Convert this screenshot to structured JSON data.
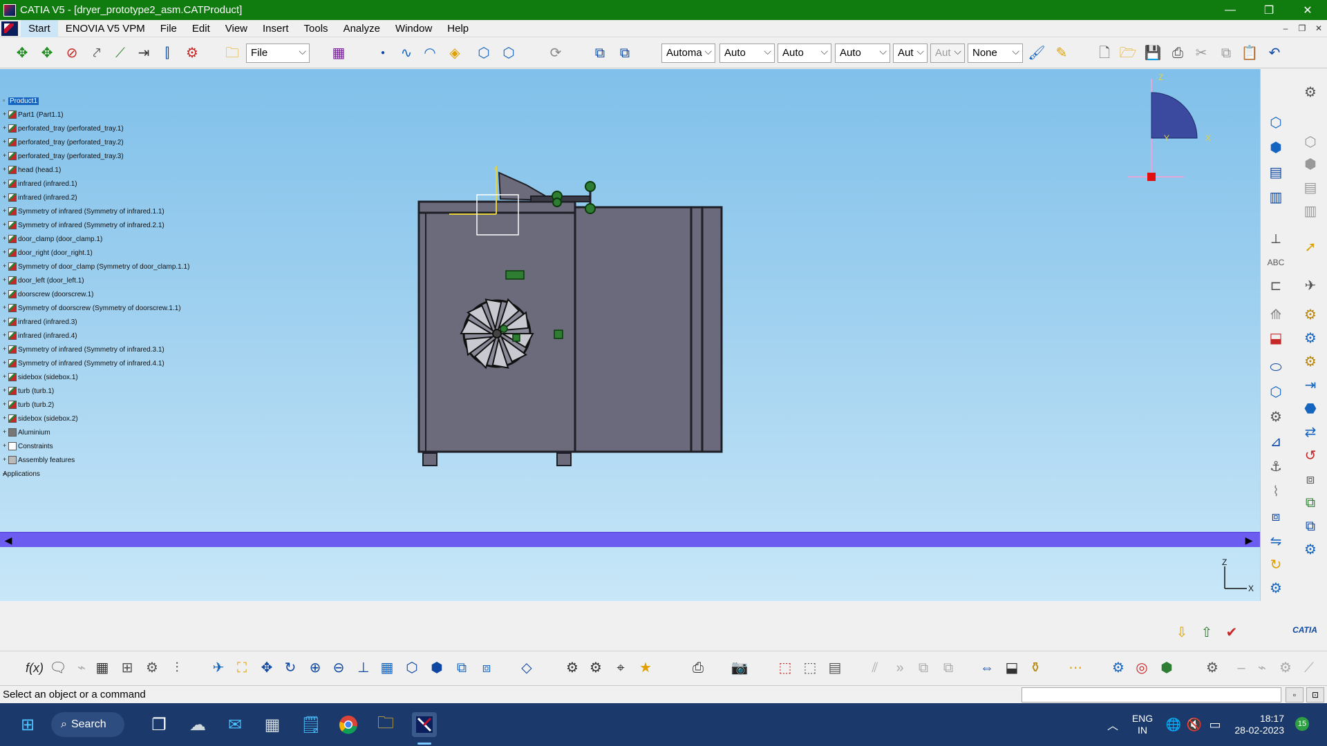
{
  "window": {
    "title": "CATIA V5 - [dryer_prototype2_asm.CATProduct]",
    "controls": {
      "minimize": "—",
      "restore": "❐",
      "close": "✕"
    }
  },
  "menubar": {
    "items": [
      "Start",
      "ENOVIA V5 VPM",
      "File",
      "Edit",
      "View",
      "Insert",
      "Tools",
      "Analyze",
      "Window",
      "Help"
    ],
    "mdi": {
      "minimize": "–",
      "restore": "❐",
      "close": "✕"
    }
  },
  "toolbar_top": {
    "file_combo": "File",
    "combos": [
      "Automa",
      "Auto",
      "Auto",
      "Auto",
      "Aut",
      "Aut",
      "None"
    ]
  },
  "tree": {
    "root": "Product1",
    "items": [
      "Part1 (Part1.1)",
      "perforated_tray (perforated_tray.1)",
      "perforated_tray (perforated_tray.2)",
      "perforated_tray (perforated_tray.3)",
      "head (head.1)",
      "infrared (infrared.1)",
      "infrared (infrared.2)",
      "Symmetry of infrared (Symmetry of infrared.1.1)",
      "Symmetry of infrared (Symmetry of infrared.2.1)",
      "door_clamp (door_clamp.1)",
      "door_right (door_right.1)",
      "Symmetry of door_clamp (Symmetry of door_clamp.1.1)",
      "door_left (door_left.1)",
      "doorscrew (doorscrew.1)",
      "Symmetry of doorscrew (Symmetry of doorscrew.1.1)",
      "infrared (infrared.3)",
      "infrared (infrared.4)",
      "Symmetry of infrared (Symmetry of infrared.3.1)",
      "Symmetry of infrared (Symmetry of infrared.4.1)",
      "sidebox (sidebox.1)",
      "turb (turb.1)",
      "turb (turb.2)",
      "sidebox (sidebox.2)"
    ],
    "nodes": [
      "Aluminium",
      "Constraints",
      "Assembly features"
    ],
    "applications": "Applications"
  },
  "compass": {
    "z": "Z",
    "x": "X",
    "y": "Y"
  },
  "axis_triad": {
    "z": "Z",
    "x": "X"
  },
  "statusbar": {
    "message": "Select an object or a command"
  },
  "taskbar": {
    "search": "Search",
    "language": "ENG",
    "region": "IN",
    "time": "18:17",
    "date": "28-02-2023",
    "notifications": "15"
  },
  "brand": {
    "logo_text": "CATIA"
  }
}
